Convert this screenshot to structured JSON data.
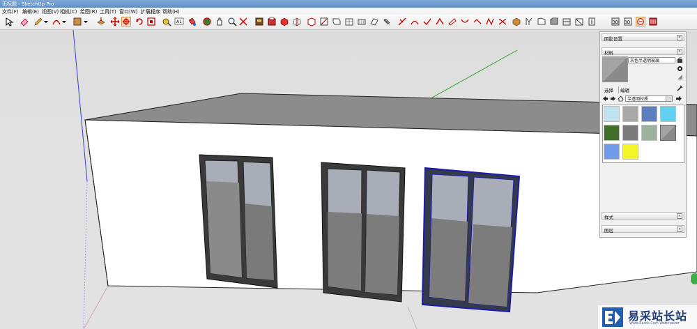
{
  "window": {
    "title": "无标题 - SketchUp Pro"
  },
  "menu": [
    "文件(F)",
    "编辑(E)",
    "视图(V)",
    "相机(C)",
    "绘图(R)",
    "工具(T)",
    "窗口(W)",
    "扩展程序",
    "帮助(H)"
  ],
  "toolbar_icons": [
    "select-icon",
    "eraser-icon",
    "pencil-icon",
    "dropdown-arrow-icon",
    "arc-icon",
    "dropdown-arrow-icon",
    "rectangle-icon",
    "dropdown-arrow-icon",
    "push-pull-icon",
    "move-icon",
    "rotate-icon",
    "scale-icon",
    "tape-measure-icon",
    "text-icon",
    "paint-bucket-icon",
    "orbit-icon",
    "pan-icon",
    "zoom-icon",
    "zoom-extents-icon",
    "warehouse-icon",
    "extension-warehouse-icon",
    "components-icon",
    "styles-icon",
    "sandbox-icon",
    "section-icon",
    "solid-tools-icon",
    "follow-me-icon",
    "offset-icon",
    "intersect-icon",
    "outer-shell-icon",
    "iso-view-icon",
    "top-view-icon",
    "front-view-icon",
    "right-view-icon",
    "back-view-icon",
    "left-view-icon",
    "xray-icon",
    "wireframe-icon",
    "hidden-line-icon",
    "shaded-icon",
    "textured-icon",
    "monochrome-icon"
  ],
  "trays": {
    "shadow": {
      "label": "阴影设置"
    },
    "materials": {
      "label": "材料",
      "current_material": "灰色半透明玻璃",
      "tab_select": "选择",
      "tab_edit": "编辑",
      "library": "半透明材质",
      "swatch_colors": [
        "#bfe3f0",
        "#a9a9a9",
        "#5b7fbf",
        "#5fd0ee",
        "#3f6f2a",
        "#7a7a7a",
        "#9fb29f",
        "#8a8a8a",
        "#6f9be8",
        "#f3f52a"
      ]
    },
    "styles": {
      "label": "样式"
    },
    "layers": {
      "label": "图层"
    }
  },
  "watermark": {
    "text": "易采站长站",
    "url": "Www.Easck.Com  Webmaster"
  },
  "colors": {
    "accent": "#5f8ec6",
    "selection": "#1a1ab0",
    "wall": "#ffffff",
    "roof": "#8c8c8c"
  }
}
